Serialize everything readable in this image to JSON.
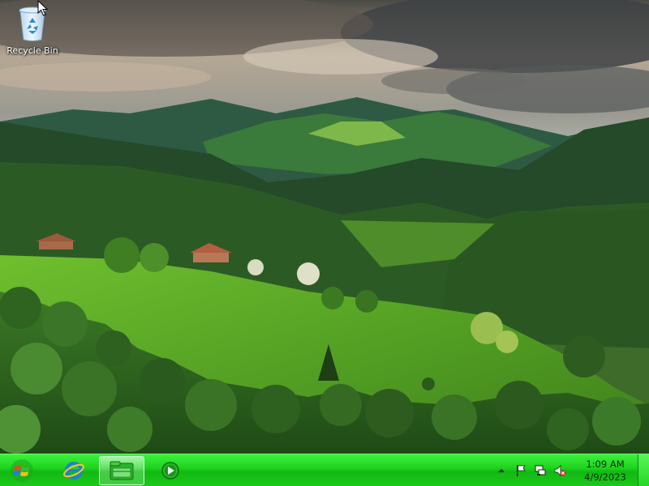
{
  "desktop": {
    "icons": [
      {
        "label": "Recycle Bin",
        "icon": "recycle-bin-icon"
      }
    ]
  },
  "taskbar": {
    "start_icon": "windows-logo-icon",
    "pinned": [
      {
        "icon": "internet-explorer-icon"
      },
      {
        "icon": "file-explorer-icon",
        "active": true
      },
      {
        "icon": "media-player-icon"
      }
    ],
    "tray": {
      "icons": [
        "show-hidden-icons-icon",
        "action-center-flag-icon",
        "network-icon",
        "volume-muted-icon"
      ],
      "time": "1:09 AM",
      "date": "4/9/2023"
    }
  },
  "colors": {
    "taskbar": "#1ed01e",
    "taskbar_highlight": "#3cf23c",
    "sky": "#8a8f8a",
    "meadow": "#5aa12a",
    "forest": "#2e5a22"
  }
}
